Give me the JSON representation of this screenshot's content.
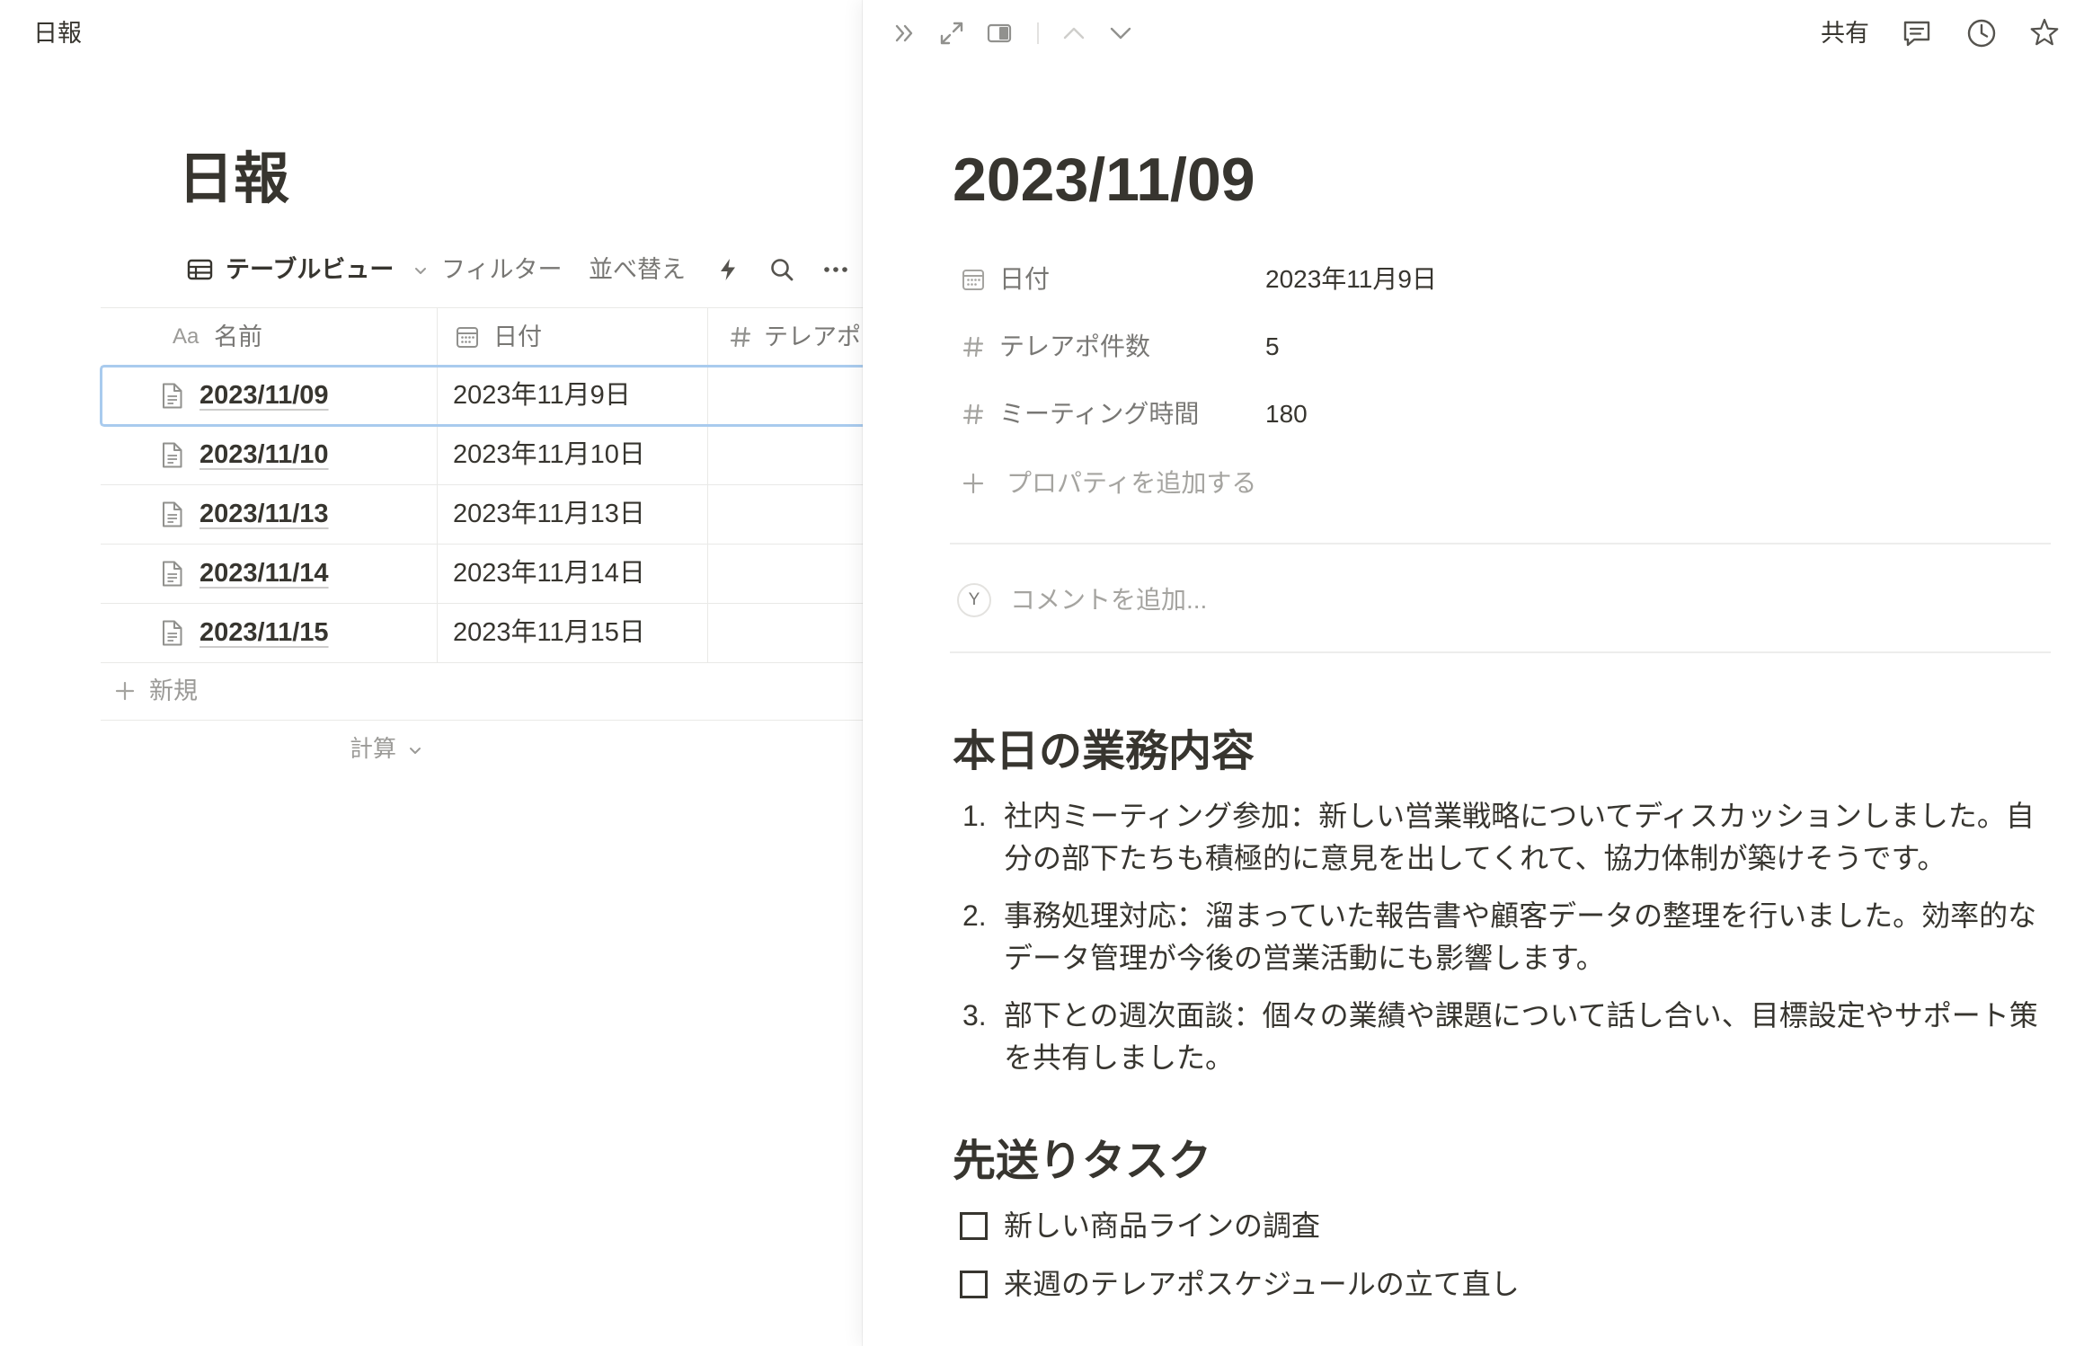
{
  "colors": {
    "text": "#37352f",
    "muted": "#9b9a97",
    "icon": "#91918e",
    "border": "#e9e9e7",
    "selection": "#a9cbee"
  },
  "left": {
    "topbar_title": "日報",
    "page_title": "日報",
    "toolbar": {
      "view_icon": "table-icon",
      "view_label": "テーブルビュー",
      "filter_label": "フィルター",
      "sort_label": "並べ替え",
      "automation_icon": "lightning-icon",
      "search_icon": "search-icon",
      "more_icon": "more-icon"
    },
    "table": {
      "columns": [
        {
          "type_label": "Aa",
          "label": "名前"
        },
        {
          "icon": "calendar-icon",
          "label": "日付"
        },
        {
          "icon": "number-icon",
          "label": "テレアポ"
        }
      ],
      "rows": [
        {
          "icon": "page-icon",
          "name": "2023/11/09",
          "date": "2023年11月9日",
          "selected": true
        },
        {
          "icon": "page-icon",
          "name": "2023/11/10",
          "date": "2023年11月10日"
        },
        {
          "icon": "page-icon",
          "name": "2023/11/13",
          "date": "2023年11月13日"
        },
        {
          "icon": "page-icon",
          "name": "2023/11/14",
          "date": "2023年11月14日"
        },
        {
          "icon": "page-icon",
          "name": "2023/11/15",
          "date": "2023年11月15日"
        }
      ],
      "new_row_label": "新規",
      "calculate_label": "計算"
    }
  },
  "peek": {
    "toolbar": {
      "left_icons": [
        "double-chevron-right-icon",
        "expand-icon",
        "side-peek-icon",
        "chevron-up-icon",
        "chevron-down-icon"
      ],
      "share_label": "共有",
      "right_icons": [
        "comment-icon",
        "clock-icon",
        "star-icon"
      ]
    },
    "title": "2023/11/09",
    "properties": [
      {
        "icon": "calendar-icon",
        "label": "日付",
        "value": "2023年11月9日"
      },
      {
        "icon": "number-icon",
        "label": "テレアポ件数",
        "value": "5"
      },
      {
        "icon": "number-icon",
        "label": "ミーティング時間",
        "value": "180"
      }
    ],
    "add_property_label": "プロパティを追加する",
    "comment": {
      "avatar_initial": "Y",
      "placeholder": "コメントを追加..."
    },
    "sections": [
      {
        "heading": "本日の業務内容",
        "items": [
          {
            "marker": "1.",
            "text": "社内ミーティング参加：新しい営業戦略についてディスカッションしました。自分の部下たちも積極的に意見を出してくれて、協力体制が築けそうです。"
          },
          {
            "marker": "2.",
            "text": "事務処理対応：溜まっていた報告書や顧客データの整理を行いました。効率的なデータ管理が今後の営業活動にも影響します。"
          },
          {
            "marker": "3.",
            "text": "部下との週次面談：個々の業績や課題について話し合い、目標設定やサポート策を共有しました。"
          }
        ]
      },
      {
        "heading": "先送りタスク",
        "items": [
          {
            "text": "新しい商品ラインの調査",
            "checked": false
          },
          {
            "text": "来週のテレアポスケジュールの立て直し",
            "checked": false
          }
        ]
      }
    ]
  }
}
